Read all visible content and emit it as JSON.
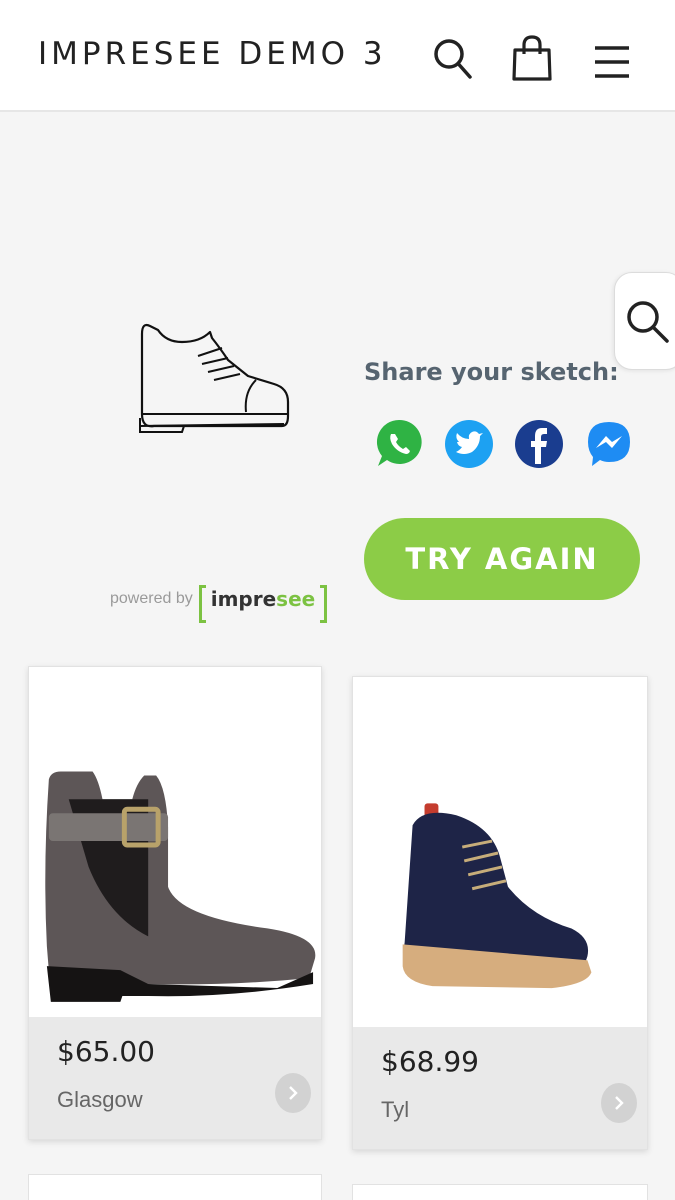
{
  "header": {
    "title": "IMPRESEE DEMO 3",
    "icons": [
      "search-icon",
      "shopping-bag-icon",
      "hamburger-menu-icon"
    ]
  },
  "side_search": {
    "icon": "search-icon"
  },
  "share": {
    "title": "Share your sketch:",
    "networks": [
      "whatsapp-icon",
      "twitter-icon",
      "facebook-icon",
      "messenger-icon"
    ]
  },
  "actions": {
    "try_again_label": "TRY AGAIN"
  },
  "powered_by": {
    "label": "powered by",
    "brand_main": "impre",
    "brand_accent": "see"
  },
  "products": [
    {
      "price": "$65.00",
      "name": "Glasgow"
    },
    {
      "price": "$68.99",
      "name": "Tyl"
    }
  ],
  "colors": {
    "accent_green": "#8ccc47",
    "share_title": "#566470",
    "whatsapp": "#2fb344",
    "twitter": "#1da1f2",
    "facebook": "#1a3d8f",
    "messenger": "#1e8cf3"
  }
}
